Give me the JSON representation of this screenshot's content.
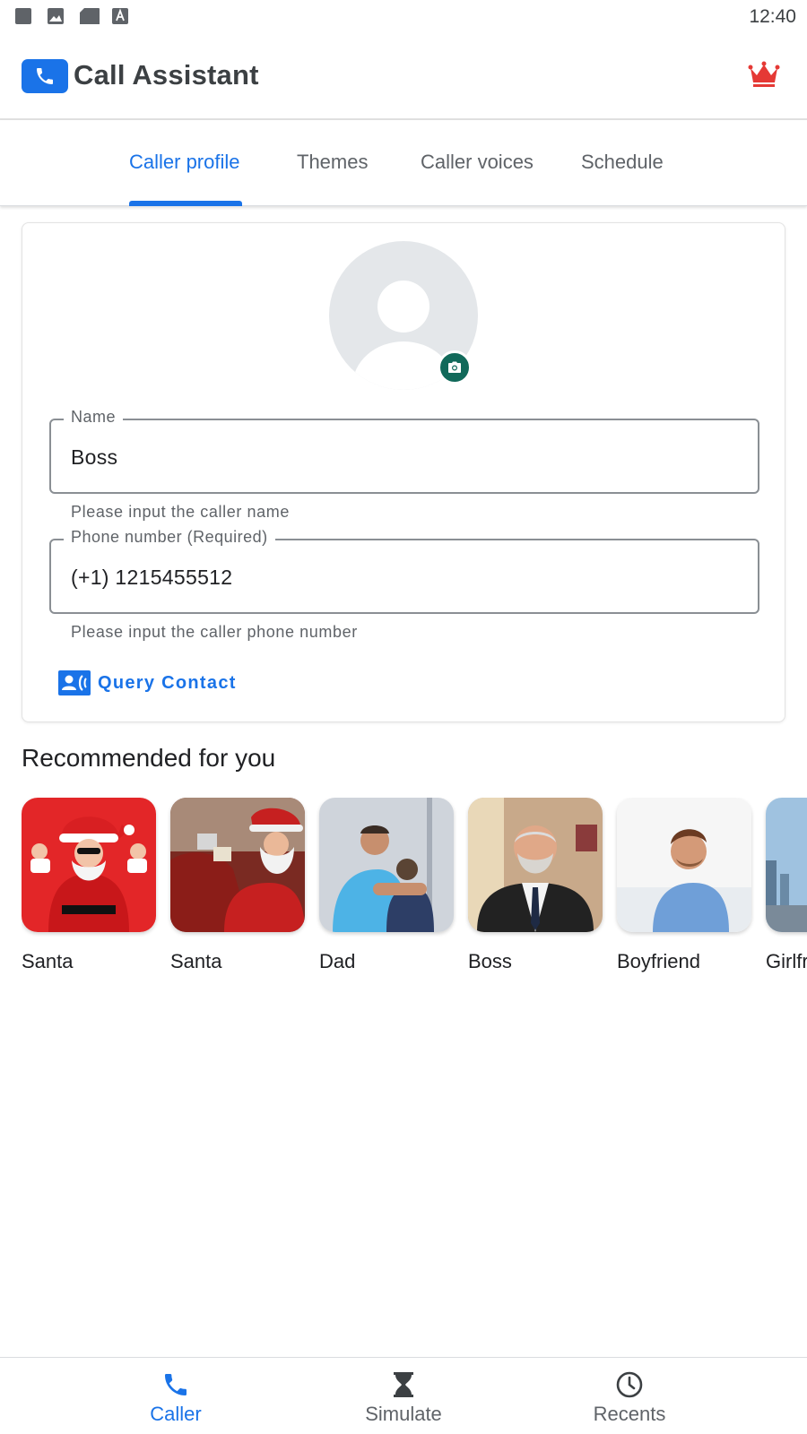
{
  "status_bar": {
    "time": "12:40",
    "icons": [
      "square-icon",
      "image-icon",
      "sd-card-icon",
      "font-a-icon"
    ]
  },
  "app_bar": {
    "title": "Call Assistant",
    "logo_icon": "phone-icon",
    "premium_icon": "crown-icon"
  },
  "tabs": [
    {
      "label": "Caller profile",
      "active": true
    },
    {
      "label": "Themes",
      "active": false
    },
    {
      "label": "Caller voices",
      "active": false
    },
    {
      "label": "Schedule",
      "active": false
    }
  ],
  "profile": {
    "avatar_icon": "person-icon",
    "camera_icon": "camera-icon",
    "name": {
      "label": "Name",
      "value": "Boss",
      "helper": "Please input the caller name"
    },
    "phone": {
      "label": "Phone number (Required)",
      "value": "(+1) 1215455512",
      "helper": "Please input the caller phone number"
    },
    "query_contact": {
      "label": "Query Contact",
      "icon": "contact-card-icon"
    }
  },
  "recommended": {
    "title": "Recommended for you",
    "items": [
      {
        "label": "Santa"
      },
      {
        "label": "Santa"
      },
      {
        "label": "Dad"
      },
      {
        "label": "Boss"
      },
      {
        "label": "Boyfriend"
      },
      {
        "label": "Girlfriend"
      }
    ]
  },
  "bottom_nav": [
    {
      "label": "Caller",
      "icon": "phone-icon",
      "active": true
    },
    {
      "label": "Simulate",
      "icon": "hourglass-icon",
      "active": false
    },
    {
      "label": "Recents",
      "icon": "clock-icon",
      "active": false
    }
  ],
  "colors": {
    "accent": "#1a73e8",
    "camera_button": "#11695a",
    "crown": "#e53935"
  }
}
